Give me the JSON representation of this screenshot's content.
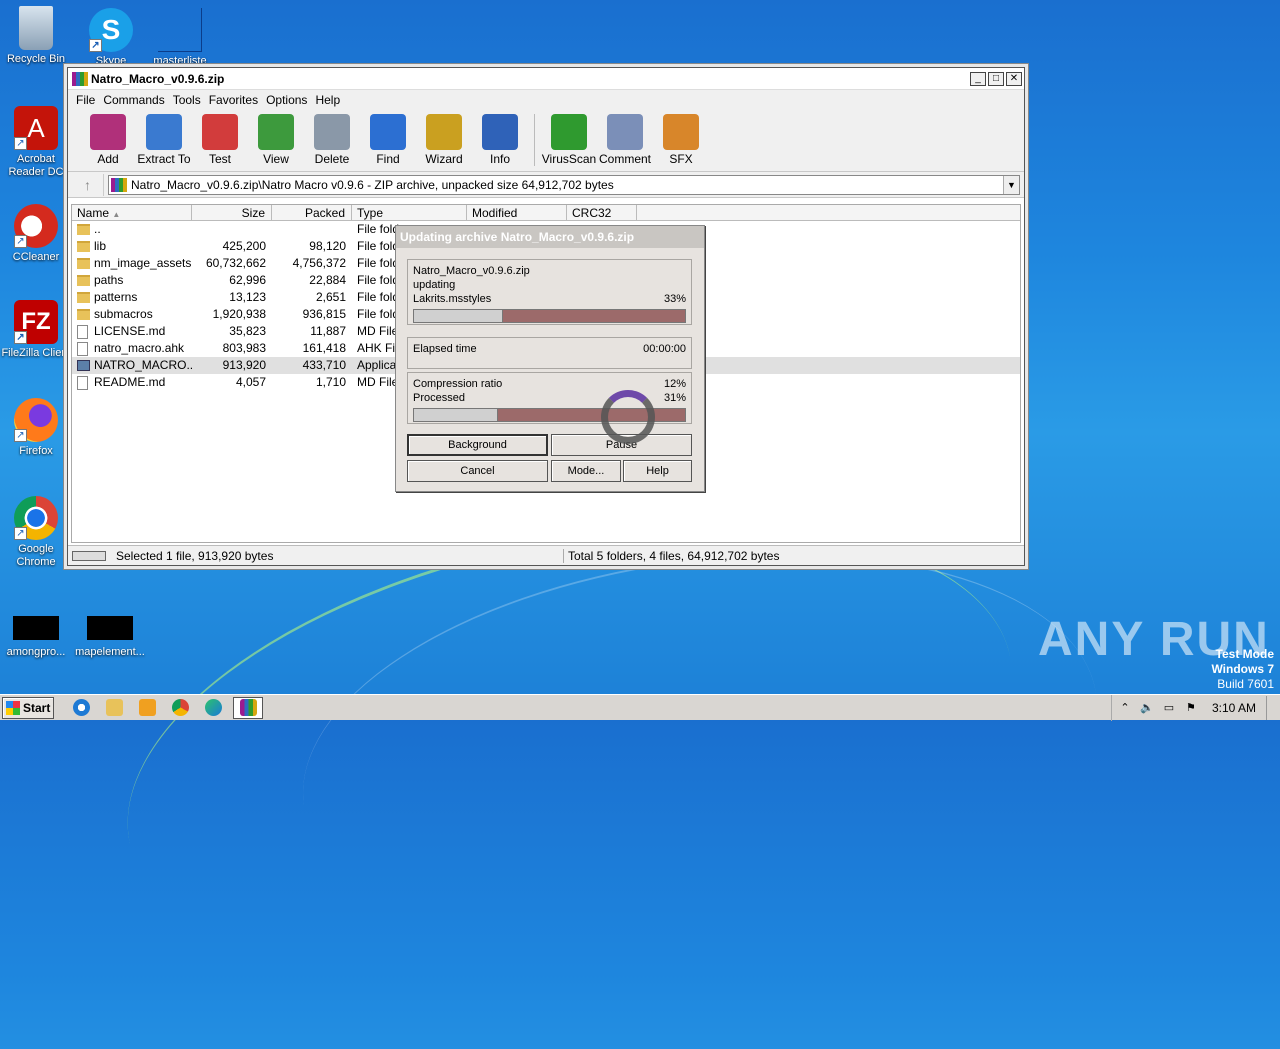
{
  "desktop": {
    "icons": [
      {
        "label": "Recycle Bin"
      },
      {
        "label": "Skype"
      },
      {
        "label": "masterliste"
      },
      {
        "label": "Acrobat Reader DC"
      },
      {
        "label": "CCleaner"
      },
      {
        "label": "FileZilla Client"
      },
      {
        "label": "Firefox"
      },
      {
        "label": "Google Chrome"
      },
      {
        "label": "amongpro..."
      },
      {
        "label": "mapelement..."
      }
    ],
    "watermark": "ANY RUN",
    "test_mode": {
      "line1": "Test Mode",
      "line2": "Windows 7",
      "line3": "Build 7601"
    }
  },
  "window": {
    "title": "Natro_Macro_v0.9.6.zip",
    "menu": [
      "File",
      "Commands",
      "Tools",
      "Favorites",
      "Options",
      "Help"
    ],
    "toolbar": [
      "Add",
      "Extract To",
      "Test",
      "View",
      "Delete",
      "Find",
      "Wizard",
      "Info",
      "VirusScan",
      "Comment",
      "SFX"
    ],
    "toolbar_colors": [
      "#b0307a",
      "#3a7ad0",
      "#d23c3c",
      "#3d9a3d",
      "#8a98a8",
      "#2c6fd2",
      "#caa020",
      "#2f62b8",
      "#2f9a2f",
      "#7b8fb8",
      "#d8862a"
    ],
    "address": "Natro_Macro_v0.9.6.zip\\Natro Macro v0.9.6 - ZIP archive, unpacked size 64,912,702 bytes",
    "columns": [
      "Name",
      "Size",
      "Packed",
      "Type",
      "Modified",
      "CRC32"
    ],
    "files": [
      {
        "name": "..",
        "size": "",
        "packed": "",
        "type": "File fold",
        "kind": "folder"
      },
      {
        "name": "lib",
        "size": "425,200",
        "packed": "98,120",
        "type": "File fold",
        "kind": "folder"
      },
      {
        "name": "nm_image_assets",
        "size": "60,732,662",
        "packed": "4,756,372",
        "type": "File fold",
        "kind": "folder"
      },
      {
        "name": "paths",
        "size": "62,996",
        "packed": "22,884",
        "type": "File fold",
        "kind": "folder"
      },
      {
        "name": "patterns",
        "size": "13,123",
        "packed": "2,651",
        "type": "File fold",
        "kind": "folder"
      },
      {
        "name": "submacros",
        "size": "1,920,938",
        "packed": "936,815",
        "type": "File fold",
        "kind": "folder"
      },
      {
        "name": "LICENSE.md",
        "size": "35,823",
        "packed": "11,887",
        "type": "MD File",
        "kind": "doc"
      },
      {
        "name": "natro_macro.ahk",
        "size": "803,983",
        "packed": "161,418",
        "type": "AHK File",
        "kind": "doc"
      },
      {
        "name": "NATRO_MACRO....",
        "size": "913,920",
        "packed": "433,710",
        "type": "Applicat",
        "kind": "app"
      },
      {
        "name": "README.md",
        "size": "4,057",
        "packed": "1,710",
        "type": "MD File",
        "kind": "doc"
      }
    ],
    "status_left": "Selected 1 file, 913,920 bytes",
    "status_right": "Total 5 folders, 4 files, 64,912,702 bytes"
  },
  "dialog": {
    "title": "Updating archive Natro_Macro_v0.9.6.zip",
    "archive": "Natro_Macro_v0.9.6.zip",
    "action": "updating",
    "current_file": "Lakrits.msstyles",
    "file_percent": "33%",
    "file_progress": 0.33,
    "elapsed_label": "Elapsed time",
    "elapsed_value": "00:00:00",
    "ratio_label": "Compression ratio",
    "ratio_value": "12%",
    "processed_label": "Processed",
    "processed_value": "31%",
    "processed_progress": 0.31,
    "buttons": {
      "background": "Background",
      "pause": "Pause",
      "cancel": "Cancel",
      "mode": "Mode...",
      "help": "Help"
    }
  },
  "taskbar": {
    "start": "Start",
    "clock": "3:10 AM"
  }
}
